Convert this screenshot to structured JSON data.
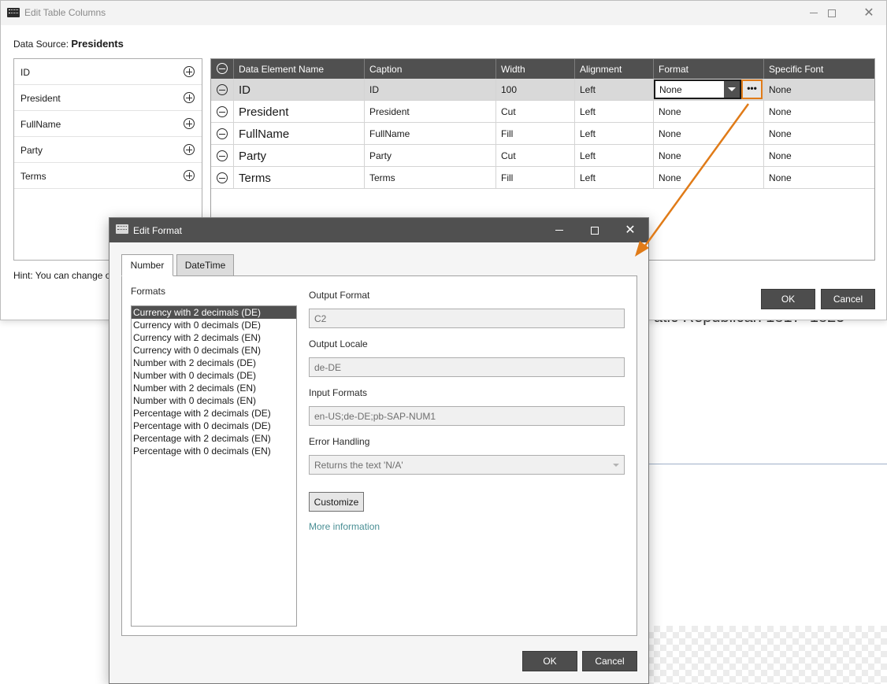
{
  "colors": {
    "accent_orange": "#e07b18",
    "dark_header": "#505050",
    "link_teal": "#4a8f95"
  },
  "background": {
    "fragment_text": "atic Republican  1817–1825"
  },
  "main_window": {
    "title": "Edit Table Columns",
    "data_source_label": "Data Source:",
    "data_source_value": "Presidents",
    "fields": [
      {
        "label": "ID",
        "icon": "add-circle-icon"
      },
      {
        "label": "President",
        "icon": "add-circle-icon"
      },
      {
        "label": "FullName",
        "icon": "add-circle-icon"
      },
      {
        "label": "Party",
        "icon": "add-circle-icon"
      },
      {
        "label": "Terms",
        "icon": "add-circle-icon"
      }
    ],
    "hint": "Hint: You can change o",
    "grid": {
      "columns": [
        "Data Element Name",
        "Caption",
        "Width",
        "Alignment",
        "Format",
        "Specific Font"
      ],
      "rows": [
        {
          "name": "ID",
          "caption": "ID",
          "width": "100",
          "alignment": "Left",
          "format": "None",
          "font": "None",
          "selected": true
        },
        {
          "name": "President",
          "caption": "President",
          "width": "Cut",
          "alignment": "Left",
          "format": "None",
          "font": "None"
        },
        {
          "name": "FullName",
          "caption": "FullName",
          "width": "Fill",
          "alignment": "Left",
          "format": "None",
          "font": "None"
        },
        {
          "name": "Party",
          "caption": "Party",
          "width": "Cut",
          "alignment": "Left",
          "format": "None",
          "font": "None"
        },
        {
          "name": "Terms",
          "caption": "Terms",
          "width": "Fill",
          "alignment": "Left",
          "format": "None",
          "font": "None"
        }
      ],
      "ellipsis": "•••"
    },
    "ok_label": "OK",
    "cancel_label": "Cancel"
  },
  "dialog": {
    "title": "Edit Format",
    "tabs": [
      "Number",
      "DateTime"
    ],
    "formats_label": "Formats",
    "formats": [
      "Currency with 2 decimals (DE)",
      "Currency with 0 decimals (DE)",
      "Currency with 2 decimals (EN)",
      "Currency with 0 decimals (EN)",
      "Number with 2 decimals (DE)",
      "Number with 0 decimals (DE)",
      "Number with 2 decimals (EN)",
      "Number with 0 decimals (EN)",
      "Percentage with 2 decimals (DE)",
      "Percentage with 0 decimals (DE)",
      "Percentage with 2 decimals (EN)",
      "Percentage with 0 decimals (EN)"
    ],
    "selected_format_index": 0,
    "output_format_label": "Output Format",
    "output_format_value": "C2",
    "output_locale_label": "Output Locale",
    "output_locale_value": "de-DE",
    "input_formats_label": "Input Formats",
    "input_formats_value": "en-US;de-DE;pb-SAP-NUM1",
    "error_handling_label": "Error Handling",
    "error_handling_value": "Returns the text 'N/A'",
    "customize_label": "Customize",
    "more_info_label": "More information",
    "ok_label": "OK",
    "cancel_label": "Cancel"
  }
}
